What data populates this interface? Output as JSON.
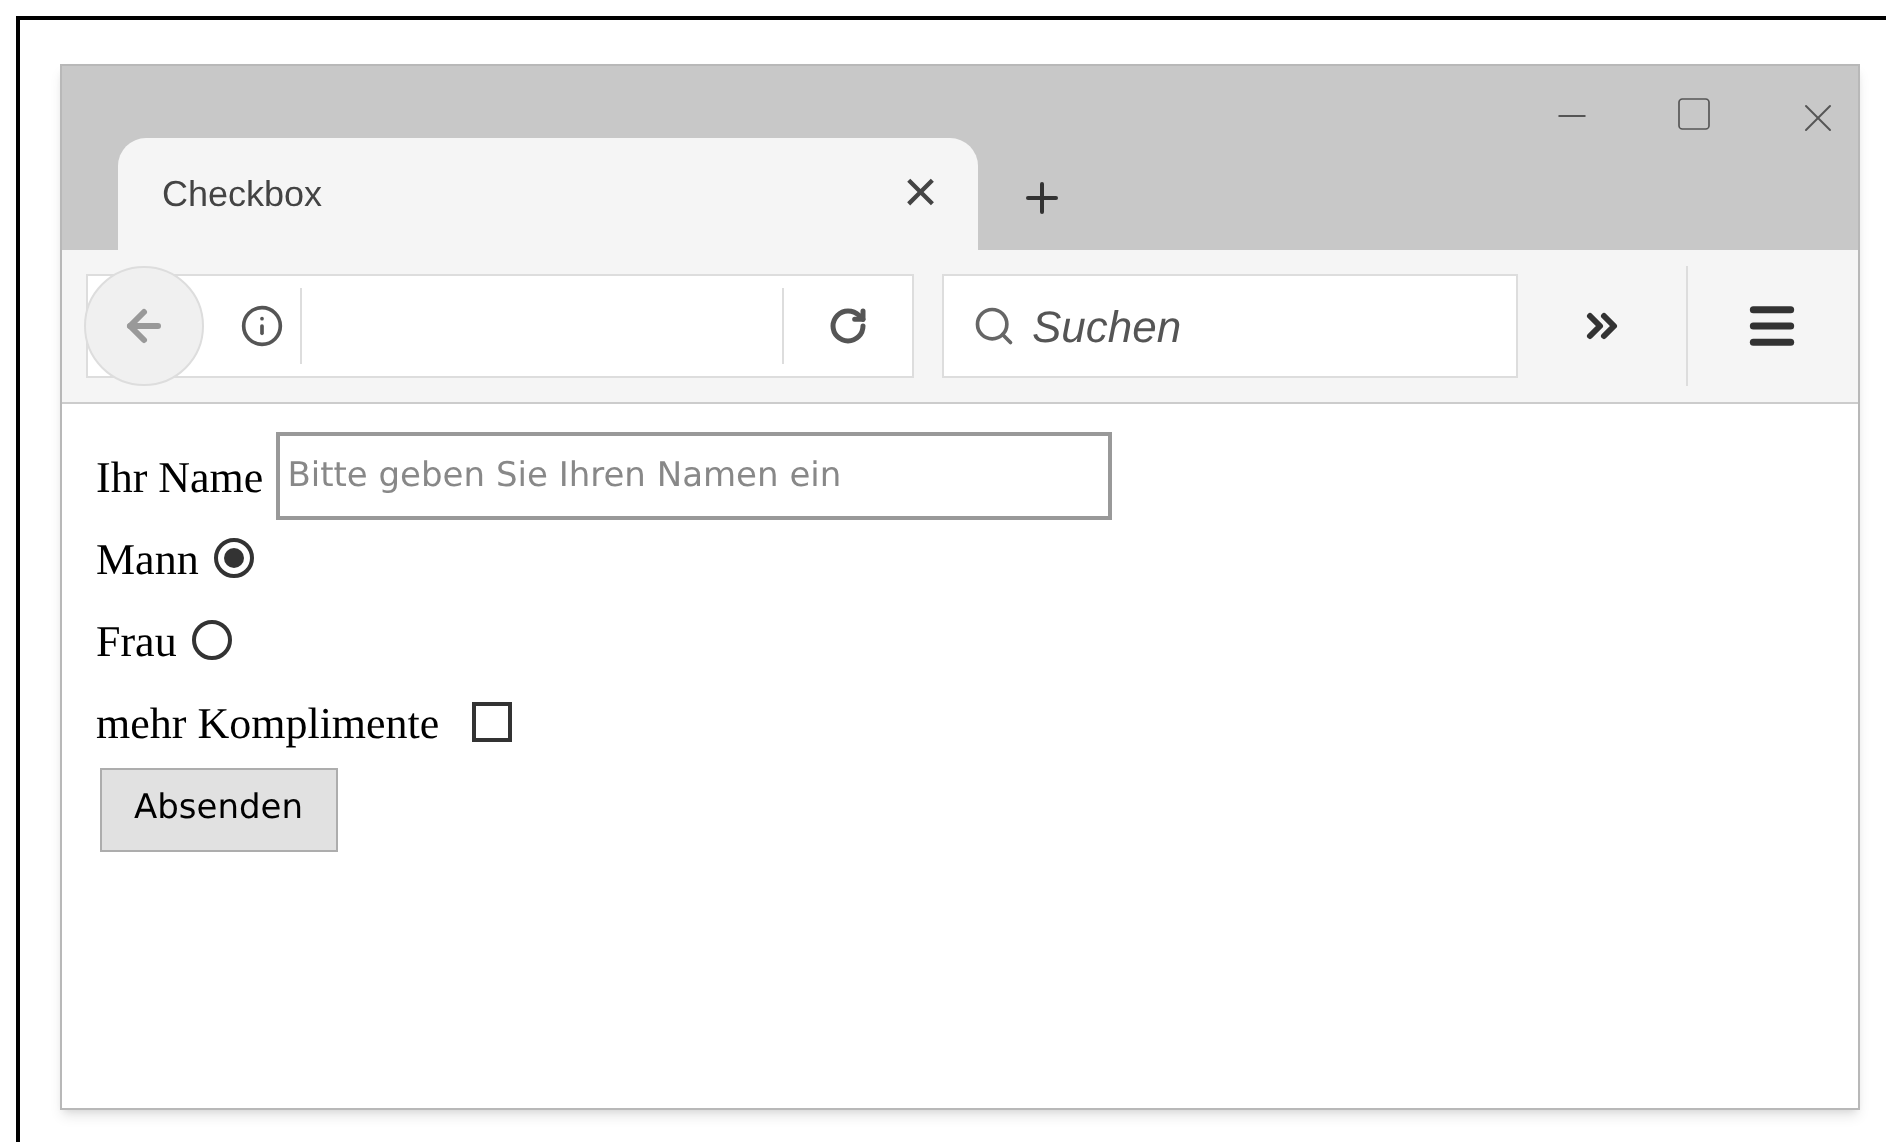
{
  "tab": {
    "title": "Checkbox",
    "close": "×"
  },
  "toolbar": {
    "search_placeholder": "Suchen"
  },
  "form": {
    "fields": [
      {
        "kind": "text",
        "label": "Ihr Name",
        "placeholder": "Bitte geben Sie Ihren Namen ein"
      },
      {
        "kind": "radio",
        "label": "Mann",
        "selected": true
      },
      {
        "kind": "radio",
        "label": "Frau",
        "selected": false
      },
      {
        "kind": "checkbox",
        "label": "mehr Komplimente",
        "checked": false
      }
    ],
    "submit": "Absenden"
  }
}
